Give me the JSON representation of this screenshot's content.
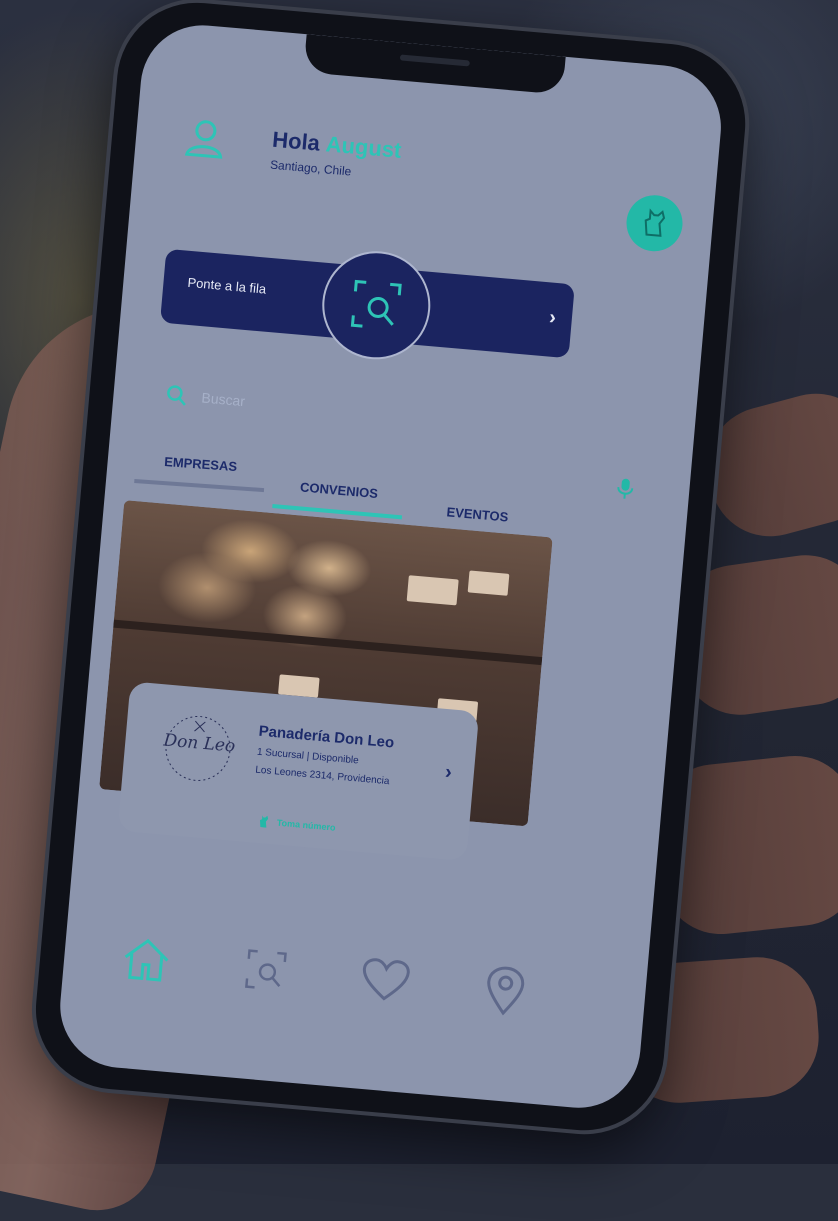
{
  "header": {
    "greeting": "Hola",
    "user_name": "August",
    "location": "Santiago, Chile"
  },
  "queue": {
    "label": "Ponte a la fila",
    "arrow": "›"
  },
  "search": {
    "placeholder": "Buscar"
  },
  "tabs": [
    {
      "label": "EMPRESAS",
      "active": false
    },
    {
      "label": "CONVENIOS",
      "active": true
    },
    {
      "label": "EVENTOS",
      "active": false
    }
  ],
  "card": {
    "logo_text": "Don Leo",
    "title": "Panadería Don Leo",
    "subtitle": "1 Sucursal | Disponible",
    "address": "Los Leones 2314, Providencia",
    "action": "Toma número",
    "arrow": "›"
  },
  "bottom_nav": [
    {
      "icon": "home-icon",
      "active": true
    },
    {
      "icon": "scan-icon",
      "active": false
    },
    {
      "icon": "heart-icon",
      "active": false
    },
    {
      "icon": "location-pin-icon",
      "active": false
    }
  ],
  "colors": {
    "brand_navy": "#1b2460",
    "accent_teal": "#2ec4b6",
    "screen_bg": "#8c95ad"
  }
}
